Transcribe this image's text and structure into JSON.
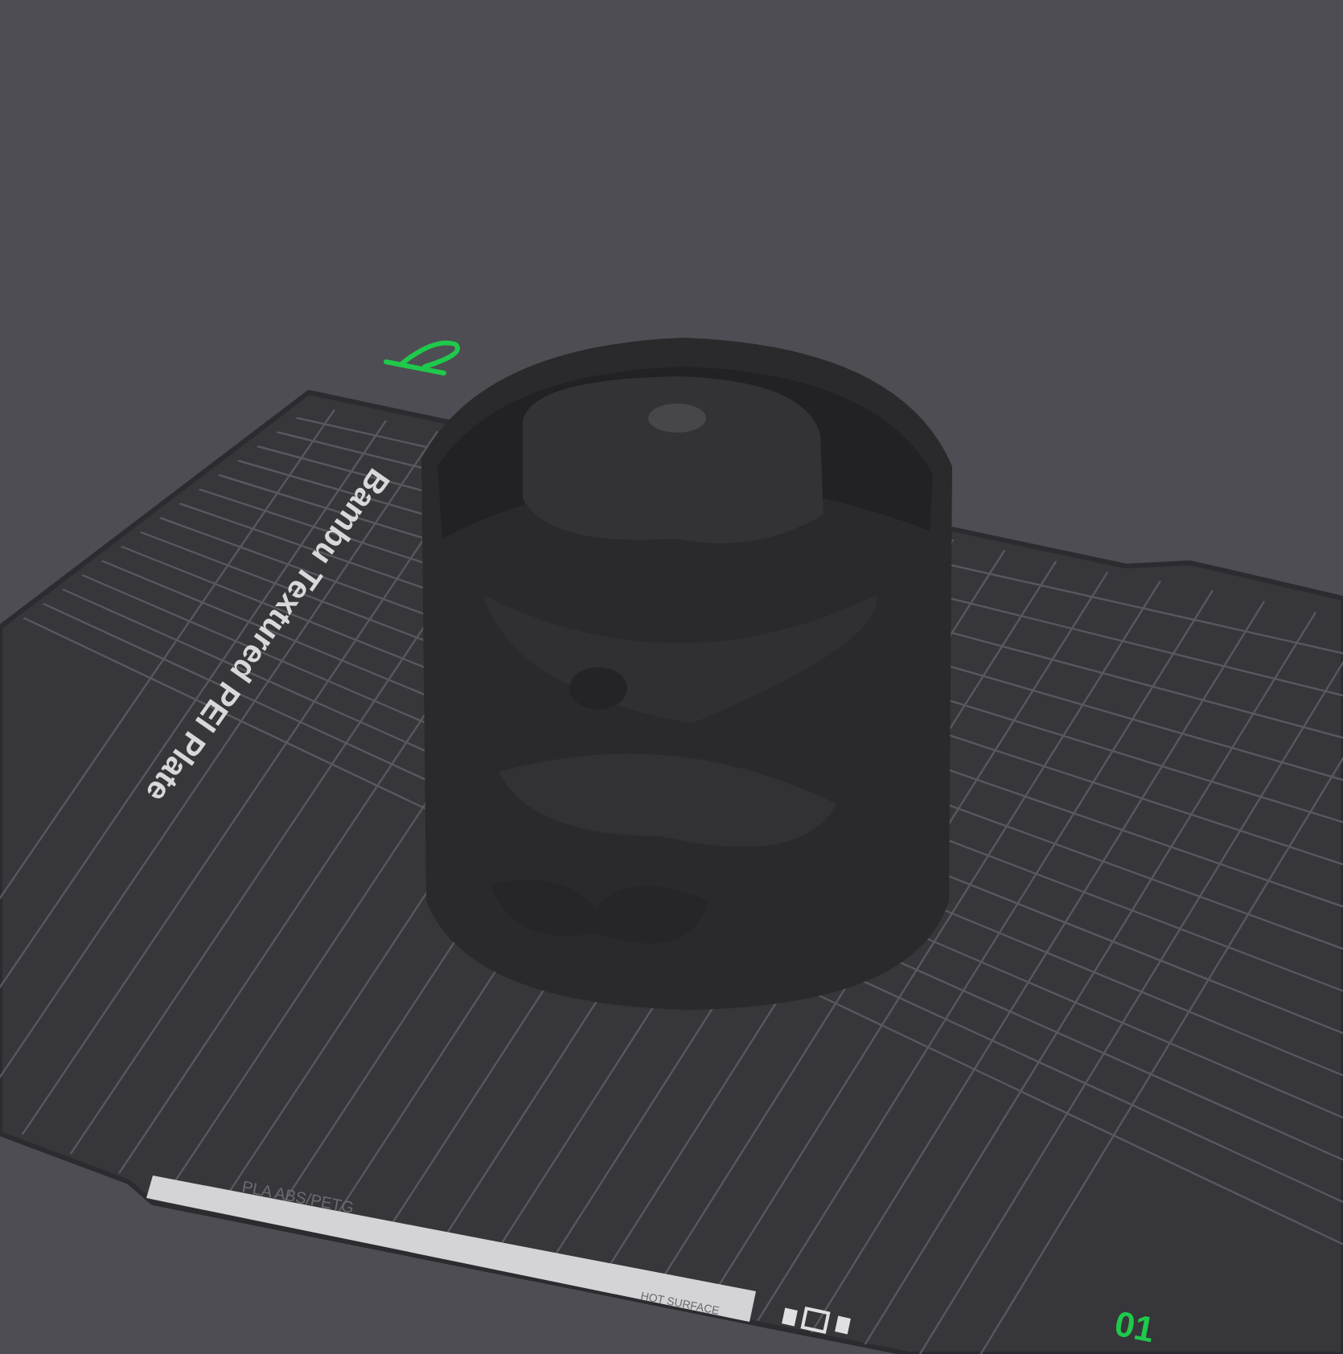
{
  "viewport": {
    "plate": {
      "name": "Bambu Textured PEI Plate",
      "label_strip": {
        "materials": "PLA ABS/PETG",
        "warning": "HOT SURFACE"
      }
    },
    "plate_number": "01"
  }
}
